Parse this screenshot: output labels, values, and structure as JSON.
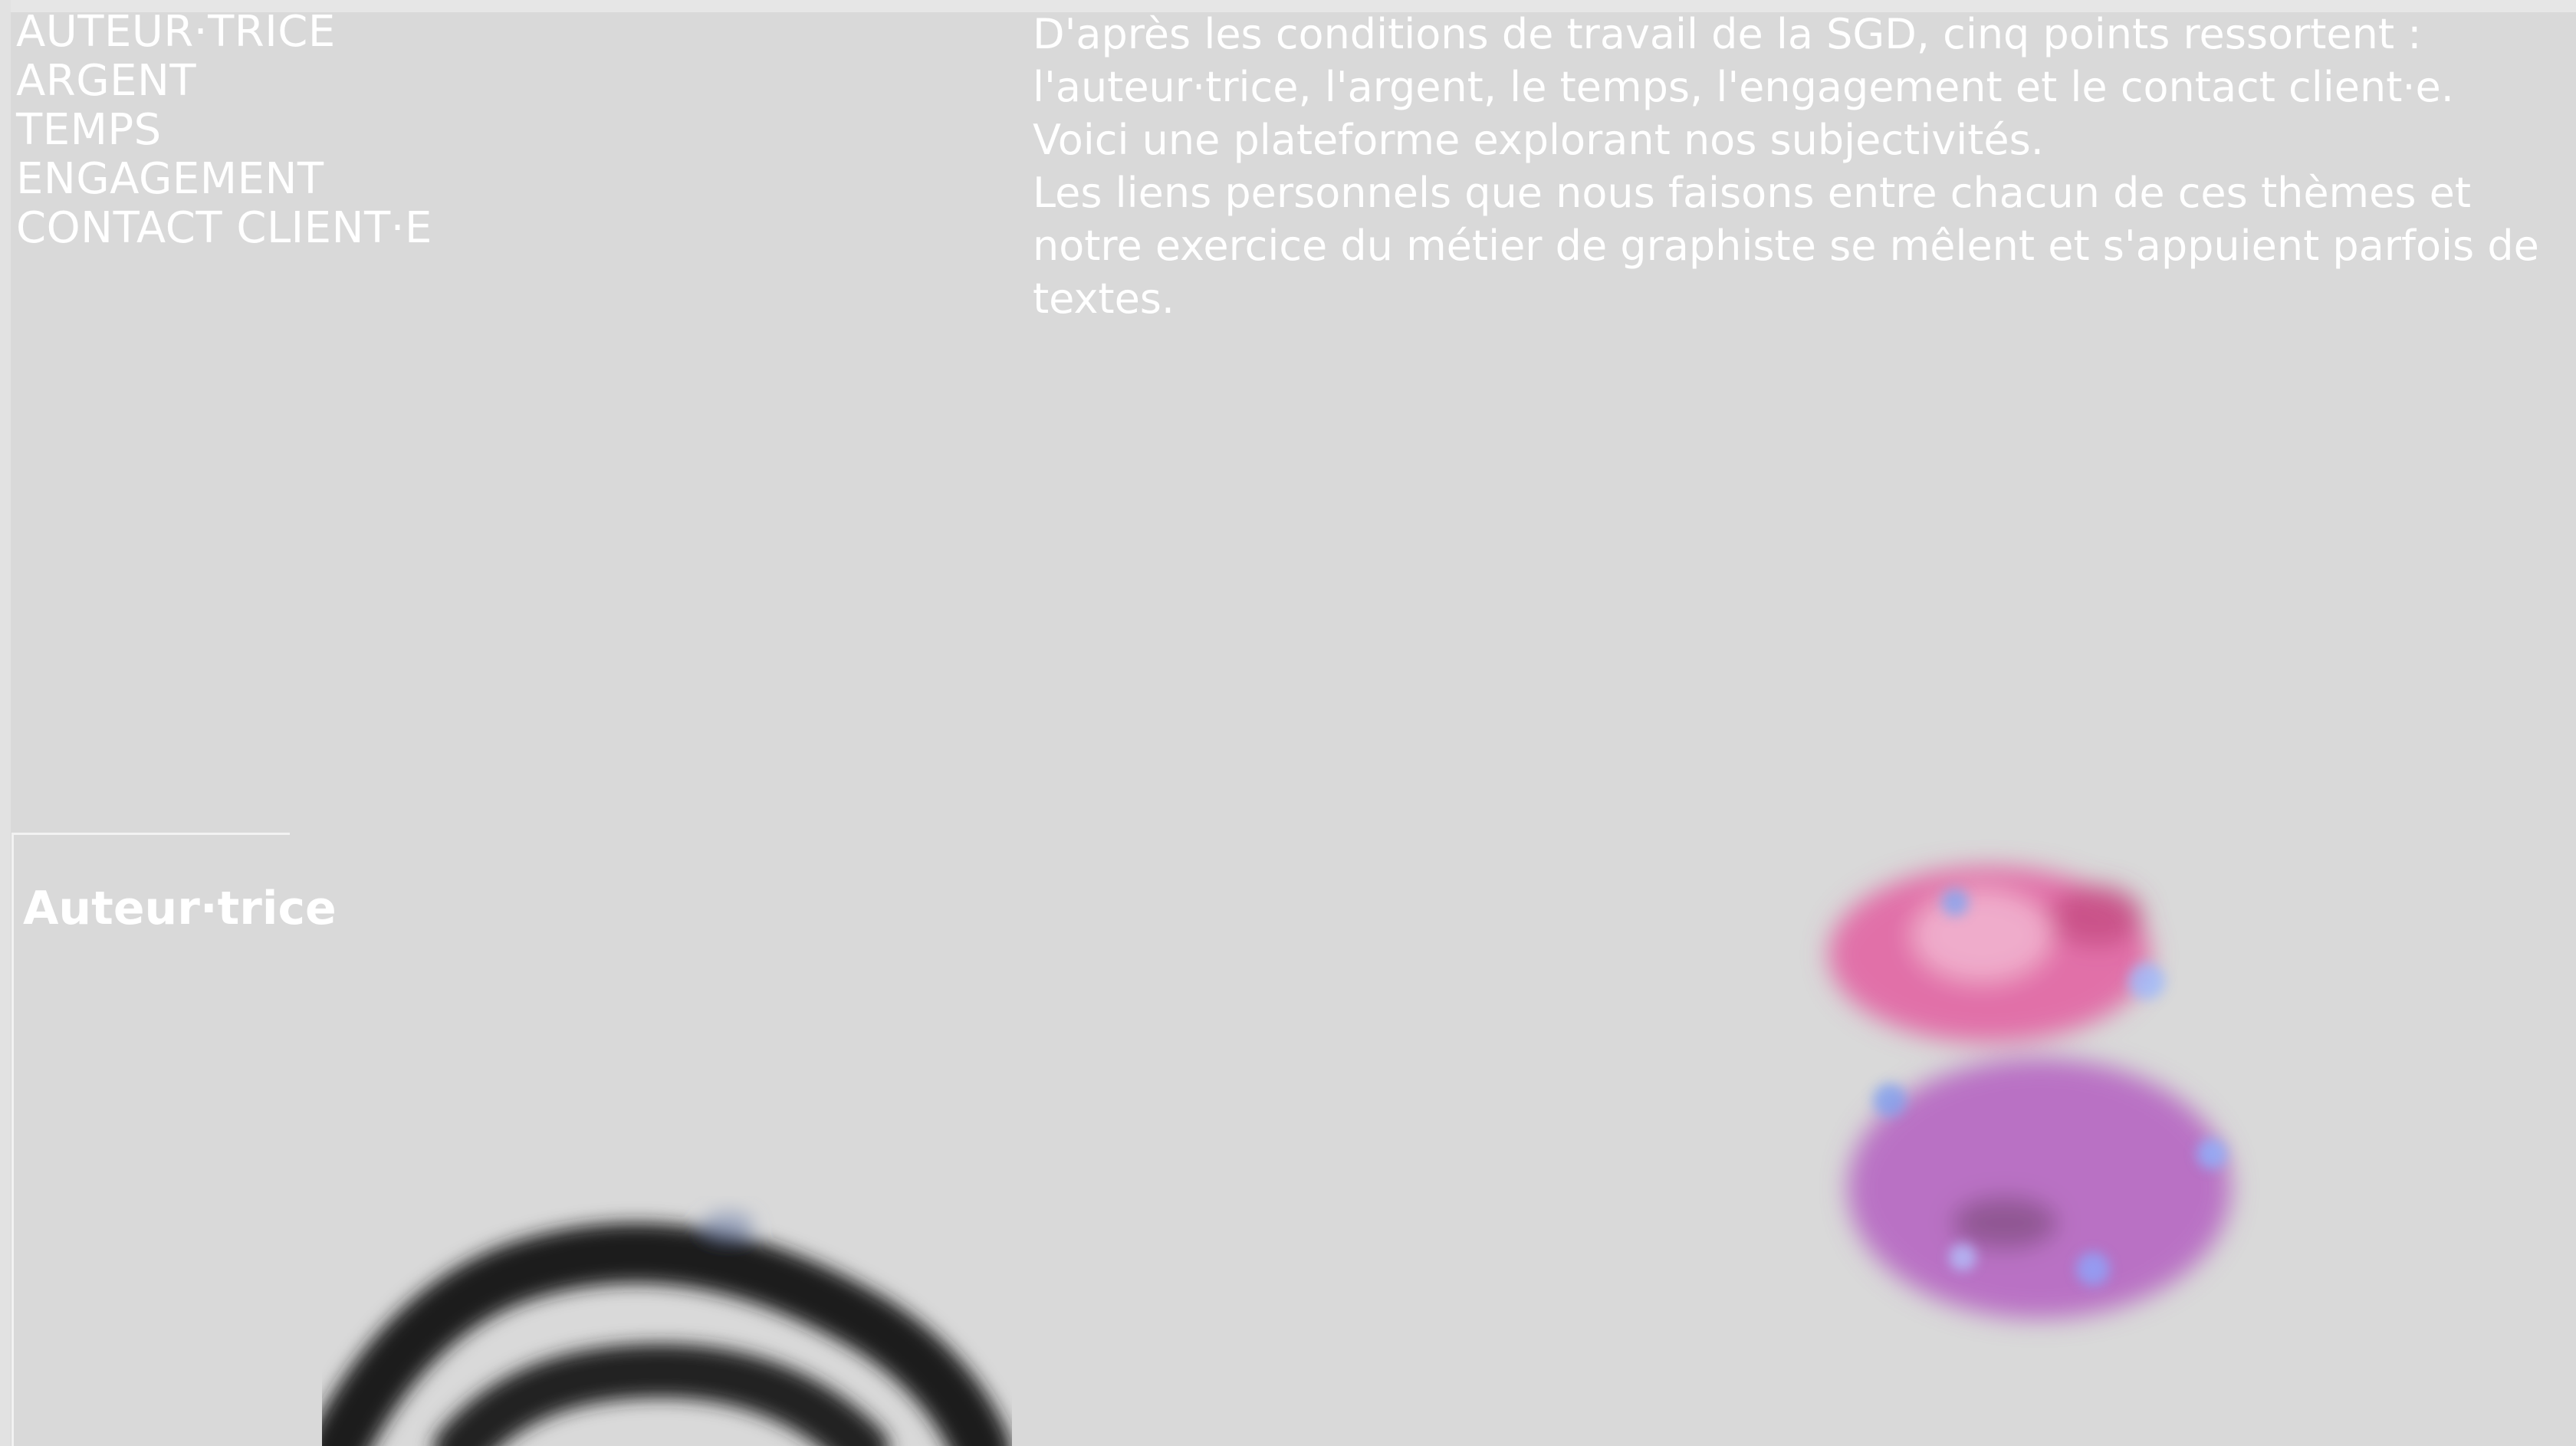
{
  "nav": {
    "items": [
      {
        "label": "AUTEUR·TRICE"
      },
      {
        "label": "ARGENT"
      },
      {
        "label": "TEMPS"
      },
      {
        "label": "ENGAGEMENT"
      },
      {
        "label": "CONTACT CLIENT·E"
      }
    ]
  },
  "intro": {
    "paragraph_1": "D'après les conditions de travail de la SGD, cinq points ressortent : l'auteur·trice, l'argent, le temps, l'engagement et le contact client·e. Voici une plateforme explorant nos subjectivités.",
    "paragraph_2": "Les liens personnels que nous faisons entre chacun de ces thèmes et notre exercice du métier de graphiste se mêlent et s'appuient parfois de textes."
  },
  "section": {
    "title": "Auteur·trice"
  },
  "images": {
    "pink_collage": "blurred-pink-collage-image",
    "ink_shape": "blurred-black-ink-shape-image"
  },
  "colors": {
    "background": "#d9d9d9",
    "text": "#ffffff",
    "pink": "#e27bae",
    "purple": "#b86bc0",
    "ink": "#1b1b1b"
  }
}
